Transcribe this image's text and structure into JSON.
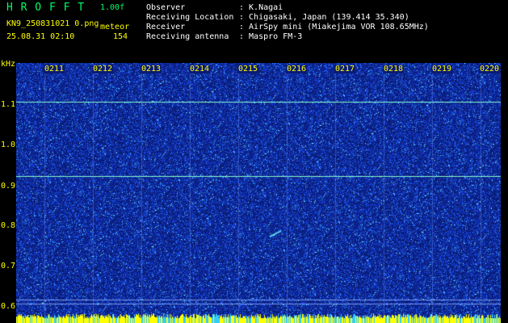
{
  "header": {
    "app_title": "H R O F F T",
    "version": "1.00f",
    "filename": "KN9_250831021 0.png",
    "mode_label": "meteor",
    "datetime": "25.08.31 02:10",
    "count": "154",
    "info": [
      {
        "label": "Observer",
        "value": ": K.Nagai"
      },
      {
        "label": "Receiving Location",
        "value": ": Chigasaki, Japan (139.414 35.340)"
      },
      {
        "label": "Receiver",
        "value": ": AirSpy mini (Miakejima VOR 108.65MHz)"
      },
      {
        "label": "Receiving antenna",
        "value": ": Maspro FM-3"
      }
    ]
  },
  "axis": {
    "unit": "kHz",
    "freq_labels": [
      "1.1",
      "1.0",
      "0.9",
      "0.8",
      "0.7",
      "0.6"
    ],
    "time_labels": [
      "0211",
      "0212",
      "0213",
      "0214",
      "0215",
      "0216",
      "0217",
      "0218",
      "0219",
      "0220"
    ]
  },
  "colors": {
    "background": "#0a1b74",
    "noise_blue": "#1e3cff",
    "noise_cyan": "#33ccff",
    "label_yellow": "#ffff00",
    "title_green": "#00ff66"
  }
}
